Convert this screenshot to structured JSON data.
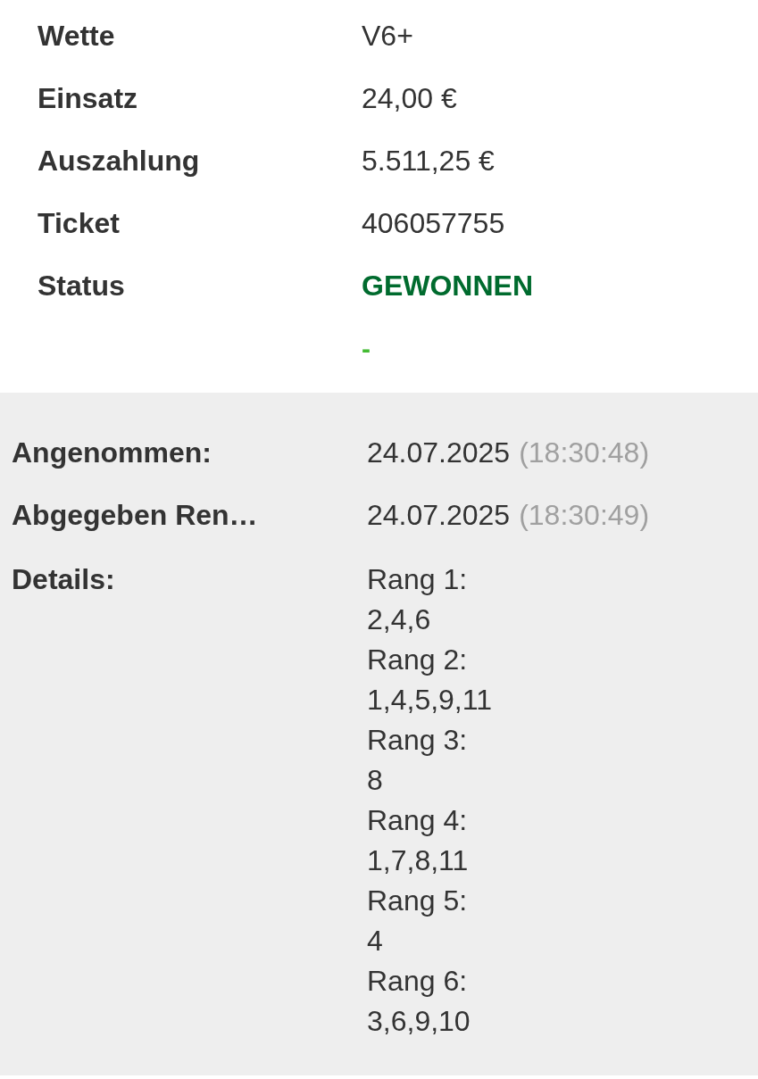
{
  "summary": {
    "rows": [
      {
        "label": "Wette",
        "value": "V6+",
        "kind": "text"
      },
      {
        "label": "Einsatz",
        "value": "24,00 €",
        "kind": "text"
      },
      {
        "label": "Auszahlung",
        "value": "5.511,25 €",
        "kind": "text"
      },
      {
        "label": "Ticket",
        "value": "406057755",
        "kind": "text"
      },
      {
        "label": "Status",
        "value": "GEWONNEN",
        "kind": "status"
      }
    ],
    "note": "-"
  },
  "info": {
    "rows": [
      {
        "label": "Angenommen:",
        "date": "24.07.2025",
        "time": "(18:30:48)"
      },
      {
        "label": "Abgegeben Ren…",
        "date": "24.07.2025",
        "time": "(18:30:49)"
      }
    ],
    "details": {
      "label": "Details:",
      "ranks": [
        {
          "rank": "Rang 1:",
          "numbers": "2,4,6"
        },
        {
          "rank": "Rang 2:",
          "numbers": "1,4,5,9,11"
        },
        {
          "rank": "Rang 3:",
          "numbers": "8"
        },
        {
          "rank": "Rang 4:",
          "numbers": "1,7,8,11"
        },
        {
          "rank": "Rang 5:",
          "numbers": "4"
        },
        {
          "rank": "Rang 6:",
          "numbers": "3,6,9,10"
        }
      ]
    }
  }
}
